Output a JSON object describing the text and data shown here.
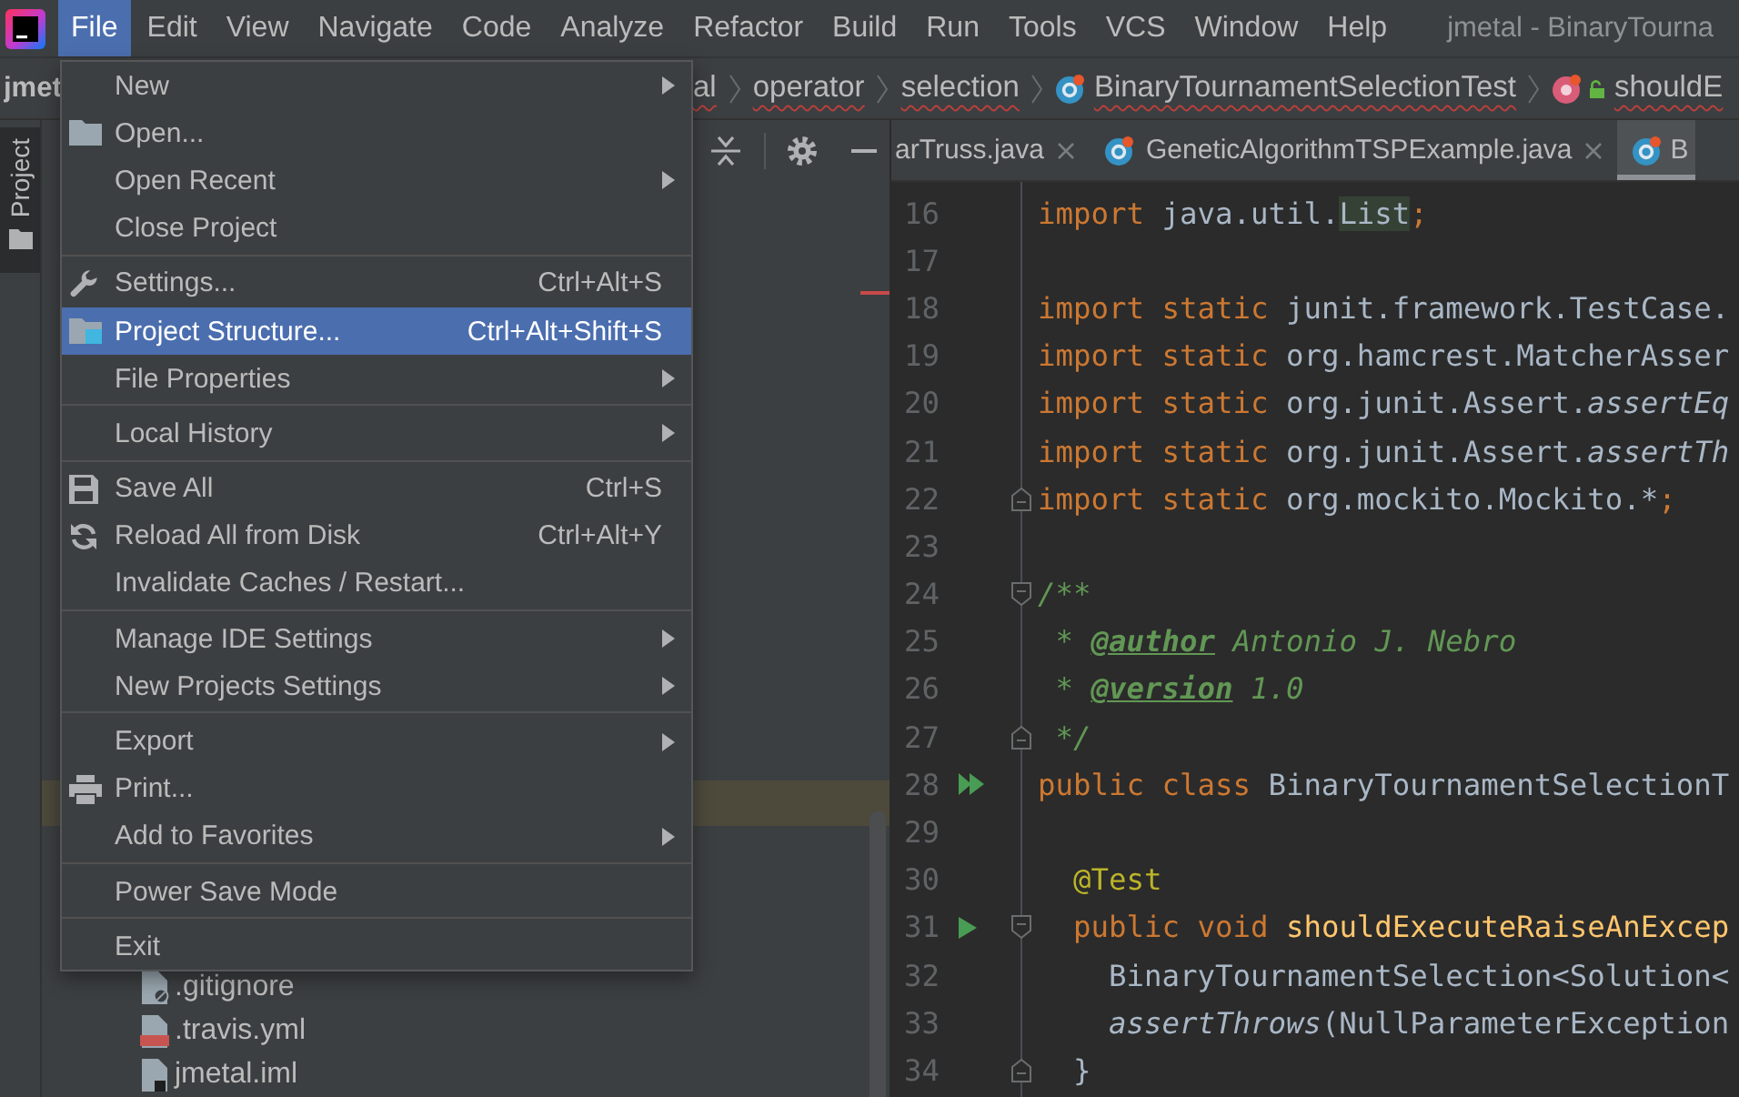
{
  "menu_bar": {
    "items": [
      {
        "label": "File",
        "selected": true
      },
      {
        "label": "Edit",
        "selected": false
      },
      {
        "label": "View",
        "selected": false
      },
      {
        "label": "Navigate",
        "selected": false
      },
      {
        "label": "Code",
        "selected": false
      },
      {
        "label": "Analyze",
        "selected": false
      },
      {
        "label": "Refactor",
        "selected": false
      },
      {
        "label": "Build",
        "selected": false
      },
      {
        "label": "Run",
        "selected": false
      },
      {
        "label": "Tools",
        "selected": false
      },
      {
        "label": "VCS",
        "selected": false
      },
      {
        "label": "Window",
        "selected": false
      },
      {
        "label": "Help",
        "selected": false
      }
    ],
    "window_title": "jmetal - BinaryTourna"
  },
  "navigation_bar": {
    "crumbs": [
      {
        "label": "jmet",
        "kind": "project",
        "error": false
      },
      {
        "label": "al",
        "kind": "package",
        "error": true
      },
      {
        "label": "operator",
        "kind": "package",
        "error": true
      },
      {
        "label": "selection",
        "kind": "package",
        "error": true
      },
      {
        "label": "BinaryTournamentSelectionTest",
        "kind": "class",
        "error": true
      },
      {
        "label": "shouldE",
        "kind": "method",
        "error": true
      }
    ]
  },
  "project_panel": {
    "tab_label": "Project",
    "tab_selected": true,
    "highlighted_row": true,
    "files": [
      {
        "label": ".gitignore",
        "kind": "ignore"
      },
      {
        "label": ".travis.yml",
        "kind": "yaml"
      },
      {
        "label": "jmetal.iml",
        "kind": "module"
      }
    ]
  },
  "editor": {
    "tabs": [
      {
        "label": "arTruss.java",
        "selected": false
      },
      {
        "label": "GeneticAlgorithmTSPExample.java",
        "selected": false
      },
      {
        "label": "B",
        "selected": true
      }
    ],
    "lines": [
      {
        "number": "16",
        "run_class": false,
        "run_method": false,
        "fold_start": false,
        "fold_end": false,
        "tokens": [
          {
            "text": "import",
            "kind": "keyword"
          },
          {
            "text": " java.util.",
            "kind": "plain"
          },
          {
            "text": "List",
            "kind": "highlight"
          },
          {
            "text": ";",
            "kind": "keyword"
          }
        ]
      },
      {
        "number": "17",
        "run_class": false,
        "run_method": false,
        "fold_start": false,
        "fold_end": false
      },
      {
        "number": "18",
        "run_class": false,
        "run_method": false,
        "fold_start": false,
        "fold_end": false,
        "tokens": [
          {
            "text": "import static",
            "kind": "keyword"
          },
          {
            "text": " junit.framework.TestCase.",
            "kind": "plain"
          }
        ]
      },
      {
        "number": "19",
        "run_class": false,
        "run_method": false,
        "fold_start": false,
        "fold_end": false,
        "tokens": [
          {
            "text": "import static",
            "kind": "keyword"
          },
          {
            "text": " org.hamcrest.MatcherAsser",
            "kind": "plain"
          }
        ]
      },
      {
        "number": "20",
        "run_class": false,
        "run_method": false,
        "fold_start": false,
        "fold_end": false,
        "tokens": [
          {
            "text": "import static",
            "kind": "keyword"
          },
          {
            "text": " org.junit.Assert.",
            "kind": "plain"
          },
          {
            "text": "assertEq",
            "kind": "static_call"
          }
        ]
      },
      {
        "number": "21",
        "run_class": false,
        "run_method": false,
        "fold_start": false,
        "fold_end": false,
        "tokens": [
          {
            "text": "import static",
            "kind": "keyword"
          },
          {
            "text": " org.junit.Assert.",
            "kind": "plain"
          },
          {
            "text": "assertTh",
            "kind": "static_call"
          }
        ]
      },
      {
        "number": "22",
        "run_class": false,
        "run_method": false,
        "fold_start": false,
        "fold_end": true,
        "tokens": [
          {
            "text": "import static",
            "kind": "keyword"
          },
          {
            "text": " org.mockito.Mockito.*",
            "kind": "plain"
          },
          {
            "text": ";",
            "kind": "keyword"
          }
        ]
      },
      {
        "number": "23",
        "run_class": false,
        "run_method": false,
        "fold_start": false,
        "fold_end": false
      },
      {
        "number": "24",
        "run_class": false,
        "run_method": false,
        "fold_start": true,
        "fold_end": false,
        "tokens": [
          {
            "text": "/**",
            "kind": "doc"
          }
        ]
      },
      {
        "number": "25",
        "run_class": false,
        "run_method": false,
        "fold_start": false,
        "fold_end": false,
        "tokens": [
          {
            "text": " * ",
            "kind": "doc"
          },
          {
            "text": "@author",
            "kind": "doc_tag"
          },
          {
            "text": " Antonio J. Nebro",
            "kind": "doc"
          }
        ]
      },
      {
        "number": "26",
        "run_class": false,
        "run_method": false,
        "fold_start": false,
        "fold_end": false,
        "tokens": [
          {
            "text": " * ",
            "kind": "doc"
          },
          {
            "text": "@version",
            "kind": "doc_tag"
          },
          {
            "text": " 1.0",
            "kind": "doc"
          }
        ]
      },
      {
        "number": "27",
        "run_class": false,
        "run_method": false,
        "fold_start": false,
        "fold_end": true,
        "tokens": [
          {
            "text": " */",
            "kind": "doc"
          }
        ]
      },
      {
        "number": "28",
        "run_class": true,
        "run_method": false,
        "fold_start": false,
        "fold_end": false,
        "tokens": [
          {
            "text": "public class",
            "kind": "keyword"
          },
          {
            "text": " BinaryTournamentSelectionT",
            "kind": "plain"
          }
        ]
      },
      {
        "number": "29",
        "run_class": false,
        "run_method": false,
        "fold_start": false,
        "fold_end": false
      },
      {
        "number": "30",
        "run_class": false,
        "run_method": false,
        "fold_start": false,
        "fold_end": false,
        "tokens": [
          {
            "text": "  @Test",
            "kind": "annotation"
          }
        ]
      },
      {
        "number": "31",
        "run_class": false,
        "run_method": true,
        "fold_start": true,
        "fold_end": false,
        "tokens": [
          {
            "text": "  public void ",
            "kind": "keyword"
          },
          {
            "text": "shouldExecuteRaiseAnExcep",
            "kind": "method_name"
          }
        ]
      },
      {
        "number": "32",
        "run_class": false,
        "run_method": false,
        "fold_start": false,
        "fold_end": false,
        "tokens": [
          {
            "text": "    BinaryTournamentSelection<Solution<",
            "kind": "plain"
          }
        ]
      },
      {
        "number": "33",
        "run_class": false,
        "run_method": false,
        "fold_start": false,
        "fold_end": false,
        "tokens": [
          {
            "text": "    assertThrows",
            "kind": "static_call"
          },
          {
            "text": "(NullParameterException",
            "kind": "plain"
          }
        ]
      },
      {
        "number": "34",
        "run_class": false,
        "run_method": false,
        "fold_start": false,
        "fold_end": true,
        "tokens": [
          {
            "text": "  }",
            "kind": "plain"
          }
        ]
      }
    ]
  },
  "file_menu": {
    "sections": [
      {
        "items": [
          {
            "label": "New",
            "submenu": true,
            "selected": false
          },
          {
            "label": "Open...",
            "submenu": false,
            "selected": false
          },
          {
            "label": "Open Recent",
            "submenu": true,
            "selected": false
          },
          {
            "label": "Close Project",
            "submenu": false,
            "selected": false
          }
        ]
      },
      {
        "items": [
          {
            "label": "Settings...",
            "shortcut": "Ctrl+Alt+S",
            "submenu": false,
            "selected": false
          },
          {
            "label": "Project Structure...",
            "shortcut": "Ctrl+Alt+Shift+S",
            "submenu": false,
            "selected": true
          },
          {
            "label": "File Properties",
            "submenu": true,
            "selected": false
          }
        ]
      },
      {
        "items": [
          {
            "label": "Local History",
            "submenu": true,
            "selected": false
          }
        ]
      },
      {
        "items": [
          {
            "label": "Save All",
            "shortcut": "Ctrl+S",
            "submenu": false,
            "selected": false
          },
          {
            "label": "Reload All from Disk",
            "shortcut": "Ctrl+Alt+Y",
            "submenu": false,
            "selected": false
          },
          {
            "label": "Invalidate Caches / Restart...",
            "submenu": false,
            "selected": false
          }
        ]
      },
      {
        "items": [
          {
            "label": "Manage IDE Settings",
            "submenu": true,
            "selected": false
          },
          {
            "label": "New Projects Settings",
            "submenu": true,
            "selected": false
          }
        ]
      },
      {
        "items": [
          {
            "label": "Export",
            "submenu": true,
            "selected": false
          },
          {
            "label": "Print...",
            "submenu": false,
            "selected": false
          },
          {
            "label": "Add to Favorites",
            "submenu": true,
            "selected": false
          }
        ]
      },
      {
        "items": [
          {
            "label": "Power Save Mode",
            "submenu": false,
            "selected": false
          }
        ]
      },
      {
        "items": [
          {
            "label": "Exit",
            "submenu": false,
            "selected": false
          }
        ]
      }
    ]
  }
}
